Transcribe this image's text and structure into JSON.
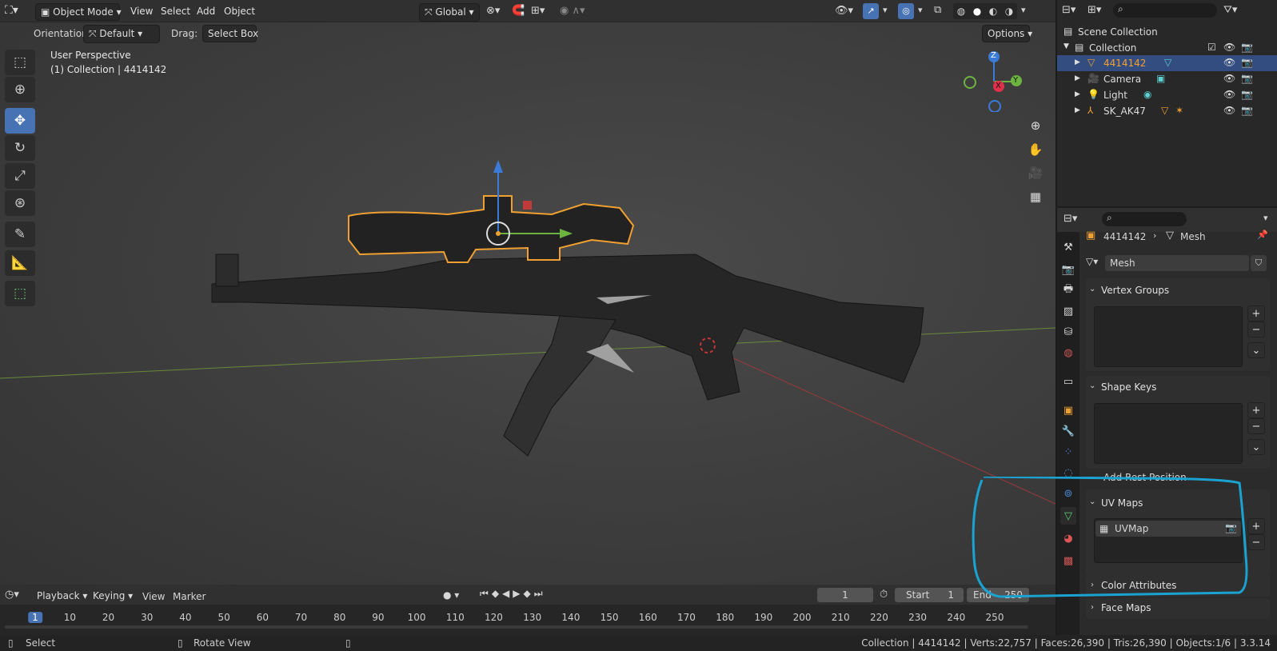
{
  "header": {
    "mode": "Object Mode",
    "menus": [
      "View",
      "Select",
      "Add",
      "Object"
    ],
    "transform_orientation": "Global"
  },
  "toolbar2": {
    "orientation_label": "Orientation:",
    "orientation_value": "Default",
    "drag_label": "Drag:",
    "drag_value": "Select Box",
    "options": "Options"
  },
  "viewport": {
    "perspective": "User Perspective",
    "collection_info": "(1) Collection | 4414142"
  },
  "gizmo": {
    "z": "Z",
    "y": "Y",
    "x": "X"
  },
  "outliner": {
    "scene_collection": "Scene Collection",
    "collection": "Collection",
    "items": [
      {
        "name": "4414142",
        "selected": true
      },
      {
        "name": "Camera"
      },
      {
        "name": "Light"
      },
      {
        "name": "SK_AK47"
      }
    ]
  },
  "properties": {
    "breadcrumb_object": "4414142",
    "breadcrumb_data": "Mesh",
    "mesh_name": "Mesh",
    "vertex_groups": "Vertex Groups",
    "shape_keys": "Shape Keys",
    "add_rest_position": "Add Rest Position",
    "uv_maps": "UV Maps",
    "uv_map_item": "UVMap",
    "color_attributes": "Color Attributes",
    "face_maps": "Face Maps"
  },
  "timeline": {
    "menus": [
      "Playback",
      "Keying",
      "View",
      "Marker"
    ],
    "current_frame": "1",
    "start_label": "Start",
    "start_value": "1",
    "end_label": "End",
    "end_value": "250",
    "frame_numbers": [
      "1",
      "10",
      "20",
      "30",
      "40",
      "50",
      "60",
      "70",
      "80",
      "90",
      "100",
      "110",
      "120",
      "130",
      "140",
      "150",
      "160",
      "170",
      "180",
      "190",
      "200",
      "210",
      "220",
      "230",
      "240",
      "250"
    ]
  },
  "status": {
    "select": "Select",
    "rotate_view": "Rotate View",
    "stats": "Collection | 4414142 | Verts:22,757 | Faces:26,390 | Tris:26,390 | Objects:1/6 | 3.3.14"
  },
  "colors": {
    "accent": "#4772b3",
    "selection_outline": "#f0a030",
    "annotation": "#1aa3d1"
  }
}
